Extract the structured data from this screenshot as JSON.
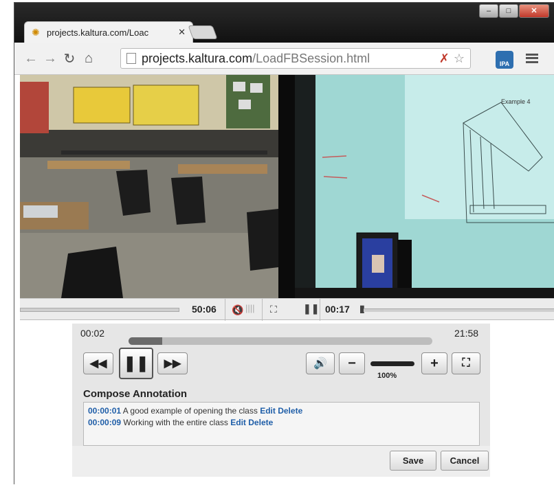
{
  "browser": {
    "tab_title": "projects.kaltura.com/Loac",
    "url_host": "projects.kaltura.com",
    "url_path": "/LoadFBSession.html",
    "ext_label": "IPA",
    "minimize": "–",
    "maximize": "□",
    "close": "✕"
  },
  "video_left": {
    "time": "50:06"
  },
  "video_right": {
    "time": "00:17",
    "board_label": "Example 4"
  },
  "player": {
    "elapsed": "00:02",
    "remaining": "21:58",
    "progress_fraction": 0.11,
    "volume_label": "100%"
  },
  "annotation": {
    "title": "Compose Annotation",
    "items": [
      {
        "time": "00:00:01",
        "text": "A good example of opening the class",
        "edit": "Edit",
        "delete": "Delete"
      },
      {
        "time": "00:00:09",
        "text": "Working with the entire class",
        "edit": "Edit",
        "delete": "Delete"
      }
    ],
    "save_label": "Save",
    "cancel_label": "Cancel"
  }
}
